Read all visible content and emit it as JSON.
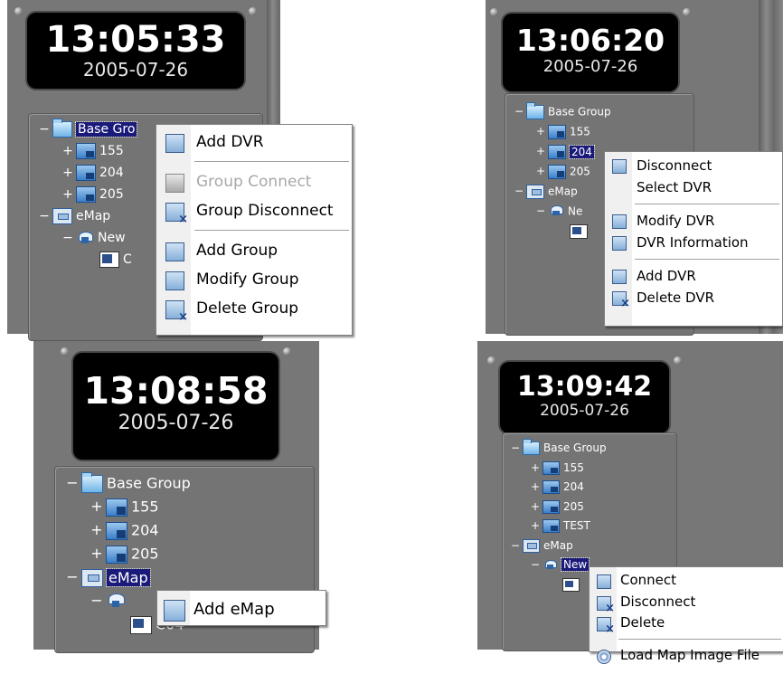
{
  "panels": [
    {
      "time": "13:05:33",
      "date": "2005-07-26",
      "tree": [
        {
          "expander": "−",
          "icon": "folder-icon",
          "label": "Base Gro",
          "selected": true
        },
        {
          "expander": "+",
          "icon": "dvr-icon",
          "label": "155"
        },
        {
          "expander": "+",
          "icon": "dvr-icon",
          "label": "204"
        },
        {
          "expander": "+",
          "icon": "dvr-icon",
          "label": "205"
        },
        {
          "expander": "−",
          "icon": "emap-icon",
          "label": "eMap"
        },
        {
          "expander": "−",
          "icon": "map-icon",
          "label": "New"
        },
        {
          "expander": "",
          "icon": "camera-icon",
          "label": "C"
        }
      ],
      "menu": [
        {
          "label": "Add DVR",
          "icon": "add-icon"
        },
        {
          "separator": true
        },
        {
          "label": "Group Connect",
          "icon": "connect-icon",
          "disabled": true
        },
        {
          "label": "Group Disconnect",
          "icon": "disconnect-icon"
        },
        {
          "separator": true
        },
        {
          "label": "Add Group",
          "icon": "add-icon"
        },
        {
          "label": "Modify Group",
          "icon": "modify-icon"
        },
        {
          "label": "Delete Group",
          "icon": "delete-icon"
        }
      ]
    },
    {
      "time": "13:06:20",
      "date": "2005-07-26",
      "tree": [
        {
          "expander": "−",
          "icon": "folder-icon",
          "label": "Base Group"
        },
        {
          "expander": "+",
          "icon": "dvr-icon",
          "label": "155"
        },
        {
          "expander": "+",
          "icon": "dvr-icon",
          "label": "204",
          "selected": true
        },
        {
          "expander": "+",
          "icon": "dvr-icon",
          "label": "205"
        },
        {
          "expander": "−",
          "icon": "emap-icon",
          "label": "eMap"
        },
        {
          "expander": "−",
          "icon": "map-icon",
          "label": "Ne"
        },
        {
          "expander": "",
          "icon": "camera-icon",
          "label": ""
        }
      ],
      "menu": [
        {
          "label": "Disconnect",
          "icon": "connect-icon"
        },
        {
          "label": "Select DVR",
          "icon": ""
        },
        {
          "separator": true
        },
        {
          "label": "Modify DVR",
          "icon": "modify-icon"
        },
        {
          "label": "DVR Information",
          "icon": "info-icon"
        },
        {
          "separator": true
        },
        {
          "label": "Add DVR",
          "icon": "add-icon"
        },
        {
          "label": "Delete DVR",
          "icon": "delete-icon"
        }
      ]
    },
    {
      "time": "13:08:58",
      "date": "2005-07-26",
      "tree": [
        {
          "expander": "−",
          "icon": "folder-icon",
          "label": "Base Group"
        },
        {
          "expander": "+",
          "icon": "dvr-icon",
          "label": "155"
        },
        {
          "expander": "+",
          "icon": "dvr-icon",
          "label": "204"
        },
        {
          "expander": "+",
          "icon": "dvr-icon",
          "label": "205"
        },
        {
          "expander": "−",
          "icon": "emap-icon",
          "label": "eMap",
          "selected": true
        },
        {
          "expander": "−",
          "icon": "map-icon",
          "label": ""
        },
        {
          "expander": "",
          "icon": "camera-icon",
          "label": "C04"
        }
      ],
      "menu": [
        {
          "label": "Add eMap",
          "icon": "add-icon"
        }
      ]
    },
    {
      "time": "13:09:42",
      "date": "2005-07-26",
      "tree": [
        {
          "expander": "−",
          "icon": "folder-icon",
          "label": "Base Group"
        },
        {
          "expander": "+",
          "icon": "dvr-icon",
          "label": "155"
        },
        {
          "expander": "+",
          "icon": "dvr-icon",
          "label": "204"
        },
        {
          "expander": "+",
          "icon": "dvr-icon",
          "label": "205"
        },
        {
          "expander": "+",
          "icon": "dvr-icon",
          "label": "TEST"
        },
        {
          "expander": "−",
          "icon": "emap-icon",
          "label": "eMap"
        },
        {
          "expander": "−",
          "icon": "map-icon",
          "label": "New",
          "selected": true
        },
        {
          "expander": "",
          "icon": "camera-icon",
          "label": ""
        }
      ],
      "menu": [
        {
          "label": "Connect",
          "icon": "connect-icon"
        },
        {
          "label": "Disconnect",
          "icon": "disconnect-icon"
        },
        {
          "label": "Delete",
          "icon": "delete-icon"
        },
        {
          "separator": true
        },
        {
          "label": "Load Map Image File",
          "icon": "gear-icon"
        }
      ]
    }
  ]
}
